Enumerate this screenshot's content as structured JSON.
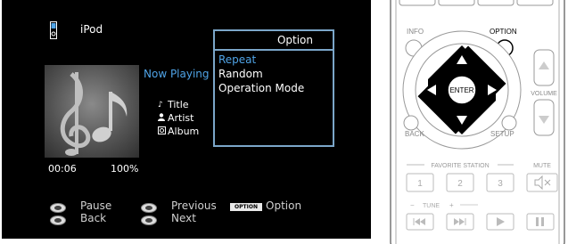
{
  "screen": {
    "source_label": "iPod",
    "now_playing_label": "Now Playing",
    "track": {
      "title": "Title",
      "artist": "Artist",
      "album": "Album"
    },
    "elapsed": "00:06",
    "progress_pct": "100%"
  },
  "option_menu": {
    "title": "Option",
    "items": [
      "Repeat",
      "Random",
      "Operation Mode"
    ],
    "selected_index": 0
  },
  "hints": {
    "pause": "Pause",
    "back": "Back",
    "previous": "Previous",
    "next": "Next",
    "option_badge": "OPTION",
    "option": "Option"
  },
  "remote": {
    "info": "INFO",
    "option": "OPTION",
    "enter": "ENTER",
    "volume": "VOLUME",
    "back": "BACK",
    "setup": "SETUP",
    "favorite_station": "FAVORITE STATION",
    "mute": "MUTE",
    "preset_1": "1",
    "preset_2": "2",
    "preset_3": "3",
    "tune": "TUNE",
    "tune_minus": "−",
    "tune_plus": "+"
  },
  "colors": {
    "screen_bg": "#000000",
    "accent_blue": "#4fa3e6",
    "panel_border": "#7ba6c9",
    "remote_highlight": "#000000"
  }
}
